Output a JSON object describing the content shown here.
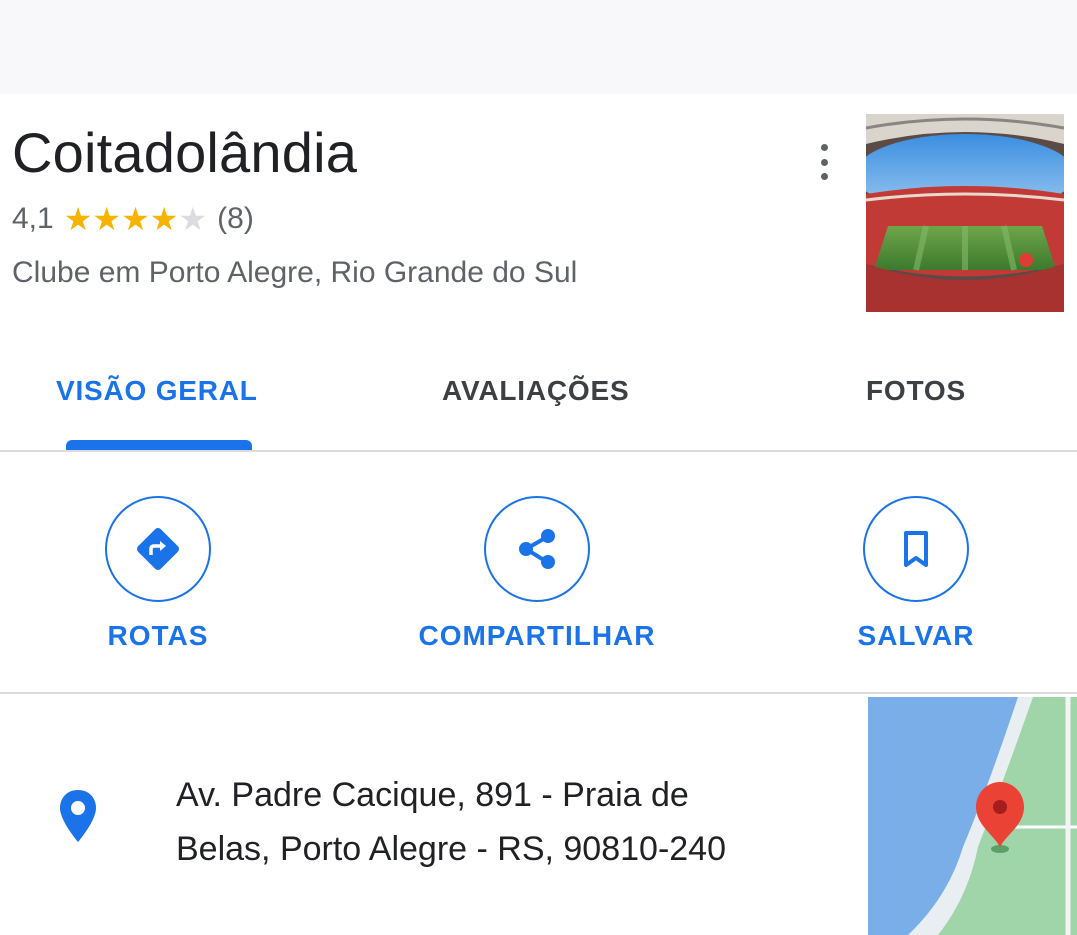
{
  "place": {
    "title": "Coitadolândia",
    "rating": "4,1",
    "rating_stars": 4.1,
    "review_count": "(8)",
    "subtitle": "Clube em Porto Alegre, Rio Grande do Sul"
  },
  "tabs": [
    {
      "label": "VISÃO GERAL",
      "active": true
    },
    {
      "label": "AVALIAÇÕES",
      "active": false
    },
    {
      "label": "FOTOS",
      "active": false
    }
  ],
  "actions": [
    {
      "label": "ROTAS",
      "icon": "directions-icon"
    },
    {
      "label": "COMPARTILHAR",
      "icon": "share-icon"
    },
    {
      "label": "SALVAR",
      "icon": "bookmark-icon"
    }
  ],
  "address": {
    "icon": "location-pin-icon",
    "line1": "Av. Padre Cacique, 891 - Praia de",
    "line2": "Belas, Porto Alegre - RS, 90810-240"
  },
  "colors": {
    "accent": "#1a73e8",
    "star": "#f6b400",
    "map_pin": "#ea4335"
  }
}
